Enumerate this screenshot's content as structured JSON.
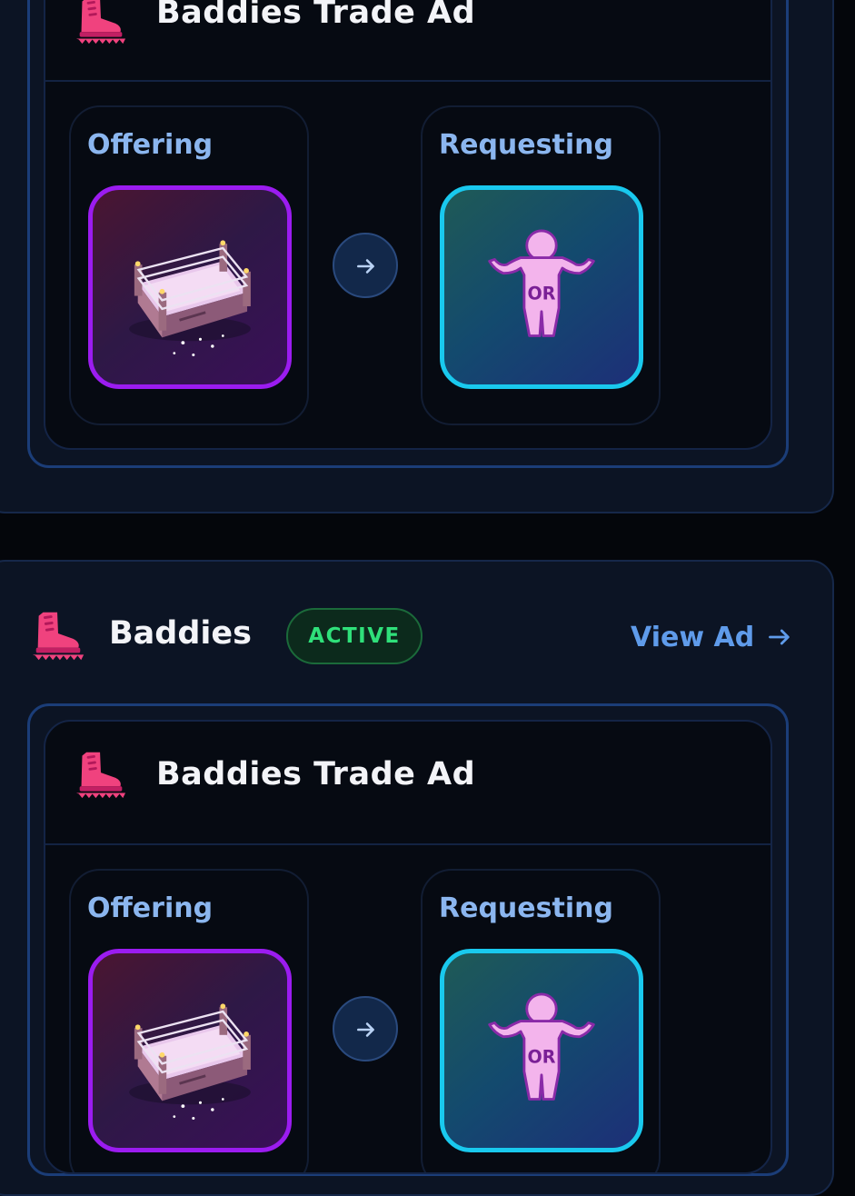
{
  "cards": [
    {
      "trade_ad": {
        "title": "Baddies Trade Ad",
        "offering_label": "Offering",
        "requesting_label": "Requesting",
        "offering_item": "wrestling-ring-icon",
        "requesting_item": "or-figure-icon",
        "requesting_item_text": "OR"
      }
    },
    {
      "game_name": "Baddies",
      "status": "ACTIVE",
      "view_ad_label": "View Ad",
      "trade_ad": {
        "title": "Baddies Trade Ad",
        "offering_label": "Offering",
        "requesting_label": "Requesting",
        "offering_item": "wrestling-ring-icon",
        "requesting_item": "or-figure-icon",
        "requesting_item_text": "OR"
      }
    }
  ],
  "colors": {
    "background": "#04060b",
    "card": "#0c1424",
    "accent_blue": "#5f9bea",
    "label_blue": "#8bb6ef",
    "active_green": "#2fe07a",
    "offer_border": "#9b1cf0",
    "request_border": "#19c9ee",
    "boot_pink": "#f0427e"
  }
}
